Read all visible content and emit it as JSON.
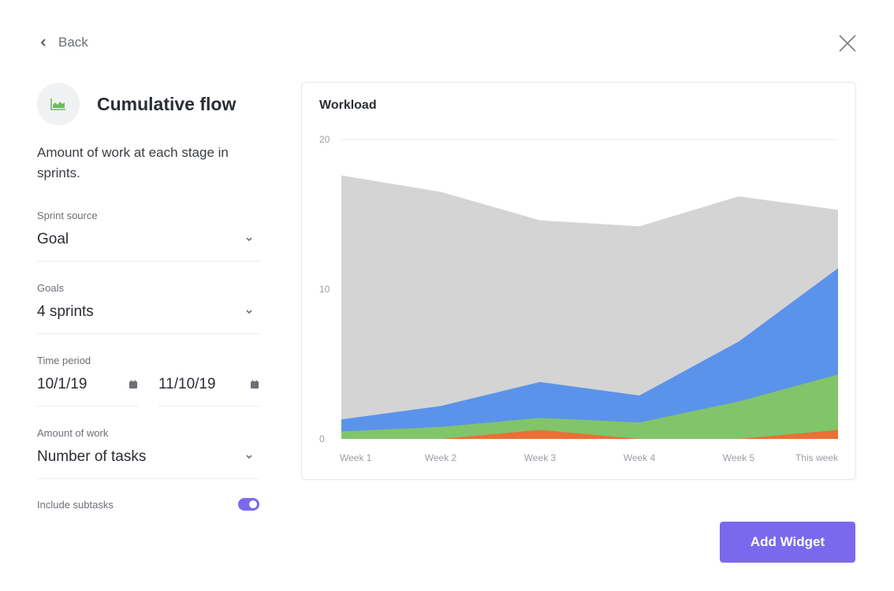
{
  "nav": {
    "back_label": "Back"
  },
  "widget": {
    "title": "Cumulative flow",
    "description": "Amount of work at each stage in sprints.",
    "icon": "area-chart-icon"
  },
  "form": {
    "sprint_source": {
      "label": "Sprint source",
      "value": "Goal"
    },
    "goals": {
      "label": "Goals",
      "value": "4 sprints"
    },
    "time_period": {
      "label": "Time period",
      "start": "10/1/19",
      "end": "11/10/19"
    },
    "amount_of_work": {
      "label": "Amount of work",
      "value": "Number of tasks"
    },
    "include_subtasks": {
      "label": "Include subtasks",
      "enabled": true
    }
  },
  "actions": {
    "add_widget_label": "Add Widget"
  },
  "colors": {
    "accent": "#7b68ee",
    "gray": "#d4d4d4",
    "blue": "#5b93ea",
    "green": "#82c46a",
    "orange": "#eb7035"
  },
  "chart_data": {
    "type": "area",
    "title": "Workload",
    "stacked": true,
    "categories": [
      "Week 1",
      "Week 2",
      "Week 3",
      "Week 4",
      "Week 5",
      "This week"
    ],
    "yticks": [
      0,
      10,
      20
    ],
    "ylim": [
      0,
      20
    ],
    "grid": true,
    "series_cumulative_tops": [
      {
        "name": "Gray stage",
        "color": "#d4d4d4",
        "values": [
          17.6,
          16.5,
          14.6,
          14.2,
          16.2,
          15.3
        ]
      },
      {
        "name": "Blue stage",
        "color": "#5b93ea",
        "values": [
          1.3,
          2.2,
          3.8,
          2.9,
          6.5,
          11.4
        ]
      },
      {
        "name": "Green stage",
        "color": "#82c46a",
        "values": [
          0.5,
          0.8,
          1.4,
          1.1,
          2.5,
          4.3
        ]
      },
      {
        "name": "Orange stage",
        "color": "#eb7035",
        "values": [
          0,
          0,
          0.6,
          0,
          0,
          0.6
        ]
      }
    ]
  }
}
